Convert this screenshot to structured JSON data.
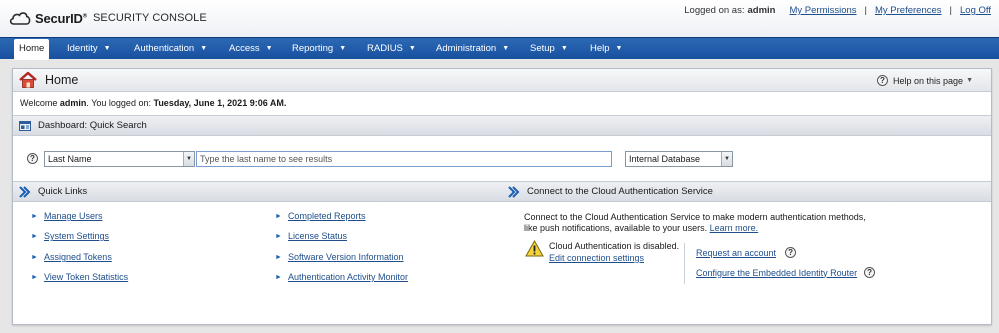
{
  "header": {
    "brand": "SecurID",
    "brand_mark": "®",
    "product": "SECURITY CONSOLE",
    "logged_on_label": "Logged on as:",
    "username": "admin",
    "links": [
      "My Permissions",
      "My Preferences",
      "Log Off"
    ]
  },
  "nav": {
    "items": [
      {
        "label": "Home",
        "caret": ""
      },
      {
        "label": "Identity",
        "caret": "▼"
      },
      {
        "label": "Authentication",
        "caret": "▼"
      },
      {
        "label": "Access",
        "caret": "▼"
      },
      {
        "label": "Reporting",
        "caret": "▼"
      },
      {
        "label": "RADIUS",
        "caret": "▼"
      },
      {
        "label": "Administration",
        "caret": "▼"
      },
      {
        "label": "Setup",
        "caret": "▼"
      },
      {
        "label": "Help",
        "caret": "▼"
      }
    ]
  },
  "page": {
    "title": "Home",
    "help_label": "Help on this page",
    "welcome_prefix": "Welcome",
    "welcome_user": "admin",
    "welcome_mid": ". You logged on:",
    "welcome_date": "Tuesday, June 1, 2021 9:06 AM."
  },
  "quick_search": {
    "title": "Dashboard: Quick Search",
    "field_value": "Last Name",
    "placeholder": "Type the last name to see results",
    "source_value": "Internal Database"
  },
  "quick_links": {
    "title": "Quick Links",
    "left": [
      "Manage Users",
      "System Settings",
      "Assigned Tokens",
      "View Token Statistics"
    ],
    "right": [
      "Completed Reports",
      "License Status",
      "Software Version Information",
      "Authentication Activity Monitor"
    ]
  },
  "cloud": {
    "title": "Connect to the Cloud Authentication Service",
    "desc_line1": "Connect to the Cloud Authentication Service to make modern authentication methods,",
    "desc_line2": "like push notifications, available to your users.",
    "learn_more": "Learn more.",
    "status": "Cloud Authentication is disabled.",
    "edit_link": "Edit connection settings",
    "request_link": "Request an account",
    "configure_link": "Configure the Embedded Identity Router"
  }
}
